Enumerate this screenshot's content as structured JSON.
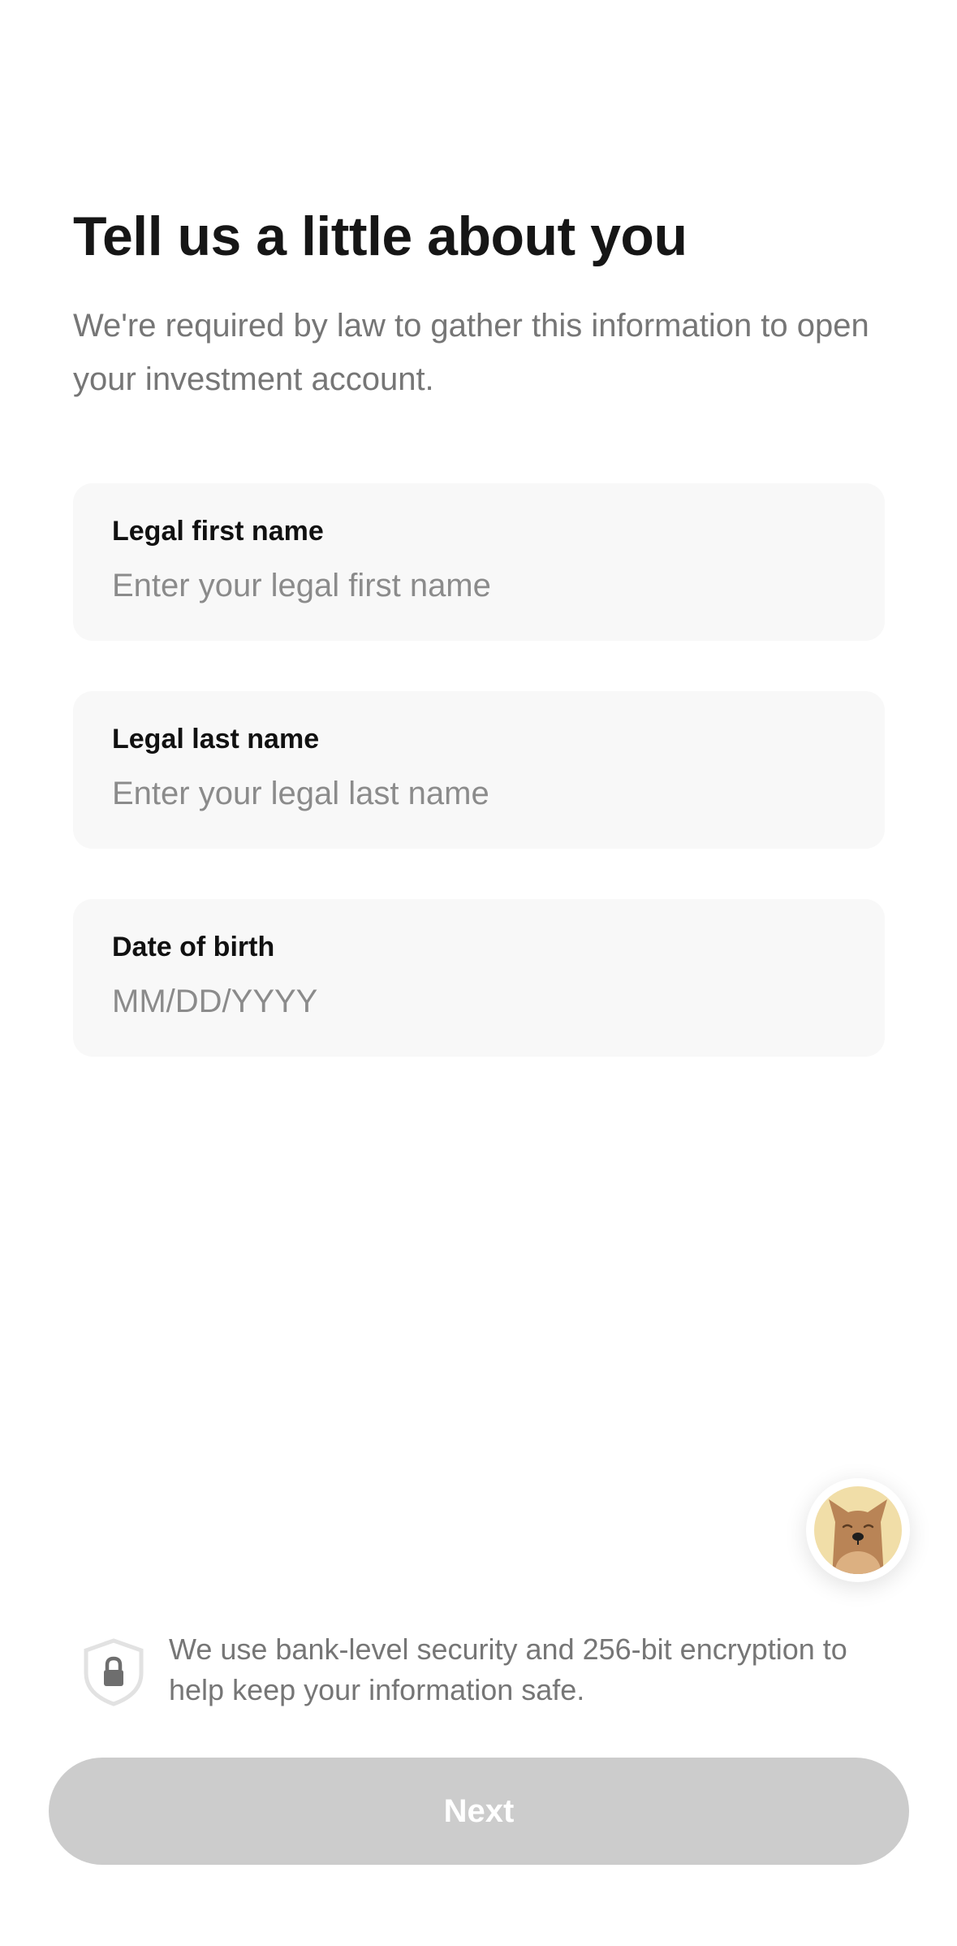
{
  "header": {
    "title": "Tell us a little about you",
    "subtitle": "We're required by law to gather this information to open your investment account."
  },
  "form": {
    "fields": [
      {
        "label": "Legal first name",
        "placeholder": "Enter your legal first name",
        "value": ""
      },
      {
        "label": "Legal last name",
        "placeholder": "Enter your legal last name",
        "value": ""
      },
      {
        "label": "Date of birth",
        "placeholder": "MM/DD/YYYY",
        "value": ""
      }
    ]
  },
  "help": {
    "icon": "dog-avatar-icon"
  },
  "security": {
    "icon": "shield-lock-icon",
    "text": "We use bank-level security and 256-bit encryption to help keep your information safe."
  },
  "actions": {
    "next_label": "Next",
    "next_enabled": false
  },
  "colors": {
    "button_disabled": "#cccccc",
    "field_background": "#f8f8f8",
    "muted_text": "#767676"
  }
}
